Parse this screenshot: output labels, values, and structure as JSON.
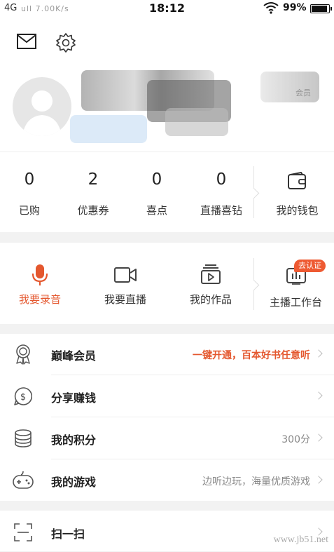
{
  "status_bar": {
    "network": "4G",
    "signal_hint": "ull 7.00K/s",
    "time": "18:12",
    "battery": "99%"
  },
  "header": {
    "mail_icon": "mail-icon",
    "settings_icon": "gear-icon",
    "member_tag": "会员"
  },
  "stats": [
    {
      "value": "0",
      "label": "已购"
    },
    {
      "value": "2",
      "label": "优惠券"
    },
    {
      "value": "0",
      "label": "喜点"
    },
    {
      "value": "0",
      "label": "直播喜钻"
    }
  ],
  "wallet": {
    "label": "我的钱包",
    "icon": "wallet-icon"
  },
  "actions": [
    {
      "label": "我要录音",
      "icon": "microphone-icon",
      "active": true
    },
    {
      "label": "我要直播",
      "icon": "video-camera-icon",
      "active": false
    },
    {
      "label": "我的作品",
      "icon": "play-box-icon",
      "active": false
    },
    {
      "label": "主播工作台",
      "icon": "dashboard-icon",
      "active": false
    }
  ],
  "anchor_badge": "去认证",
  "menu": [
    {
      "title": "巅峰会员",
      "value": "一键开通，百本好书任意听",
      "icon": "medal-icon",
      "highlight": true
    },
    {
      "title": "分享赚钱",
      "value": "",
      "icon": "dollar-icon",
      "highlight": false
    },
    {
      "title": "我的积分",
      "value": "300分",
      "icon": "coins-icon",
      "highlight": false
    },
    {
      "title": "我的游戏",
      "value": "边听边玩，海量优质游戏",
      "icon": "gamepad-icon",
      "highlight": false
    }
  ],
  "menu2": [
    {
      "title": "扫一扫",
      "icon": "scan-icon"
    }
  ],
  "watermark": "www.jb51.net",
  "colors": {
    "accent": "#e4572e",
    "background": "#f2f2f2"
  }
}
